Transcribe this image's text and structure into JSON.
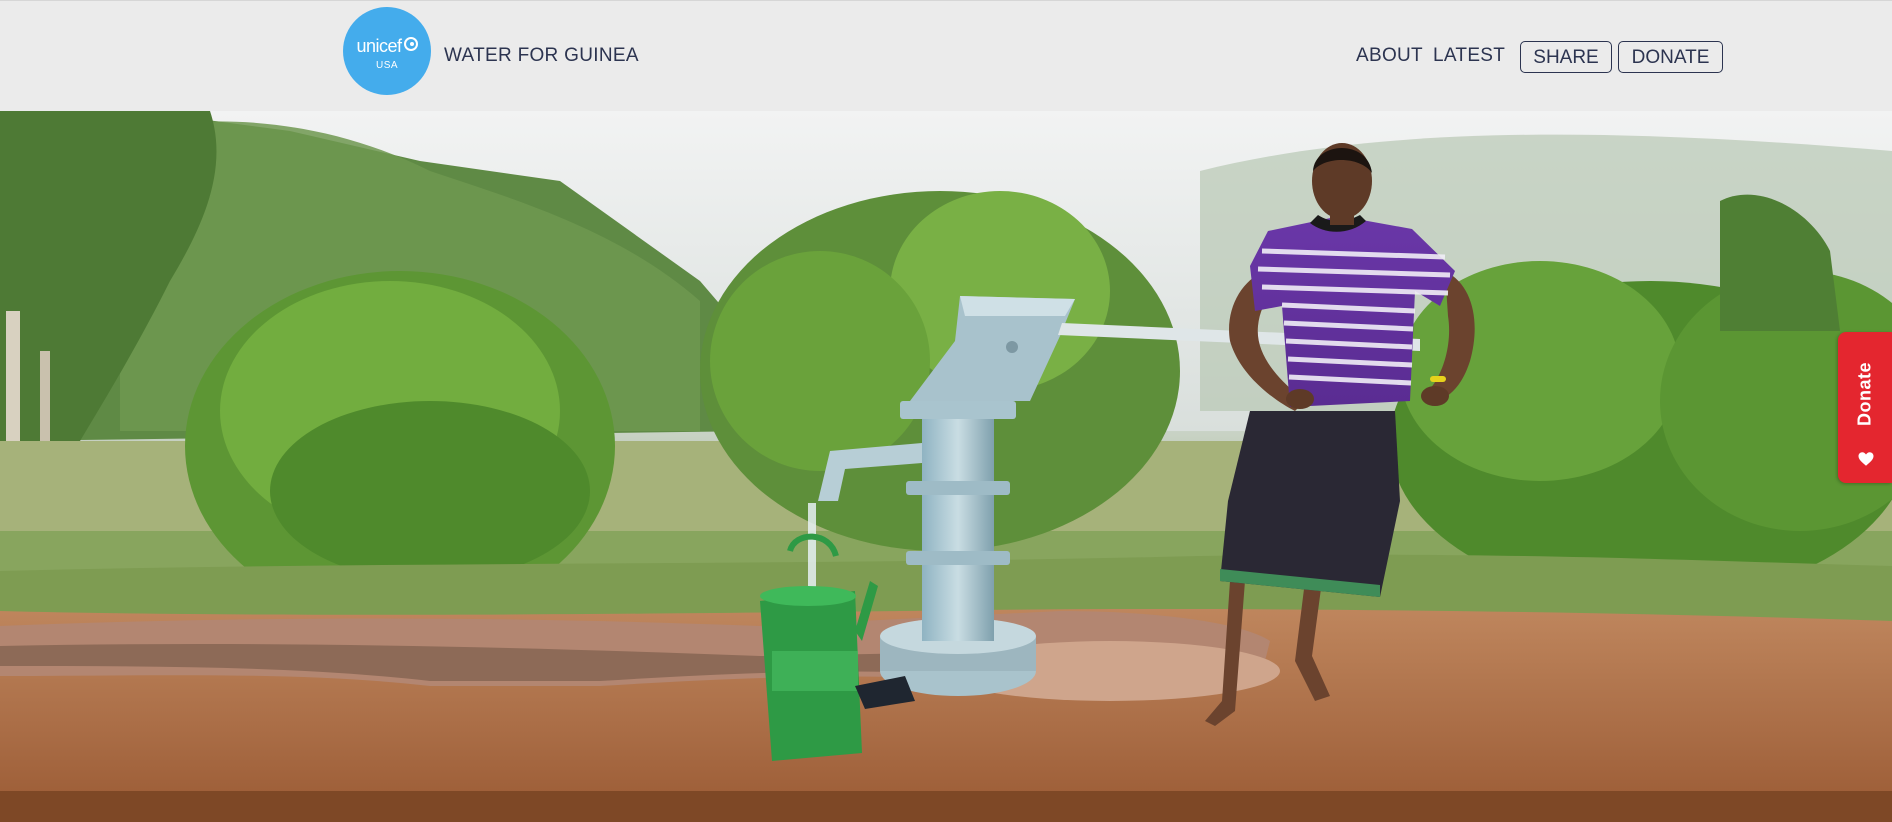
{
  "header": {
    "logo": {
      "wordmark": "unicef",
      "sub": "USA",
      "icon": "unicef-globe-icon",
      "color": "#44acec"
    },
    "site_title": "WATER FOR GUINEA",
    "nav": {
      "about": "ABOUT",
      "latest": "LATEST"
    },
    "buttons": {
      "share": "SHARE",
      "donate": "DONATE"
    },
    "text_color": "#2c3450",
    "background": "#ebebeb"
  },
  "hero": {
    "image_subject": "girl operating a hand water pump filling a green watering can"
  },
  "side_tab": {
    "label": "Donate",
    "icon": "heart-icon",
    "color": "#e4262f"
  }
}
